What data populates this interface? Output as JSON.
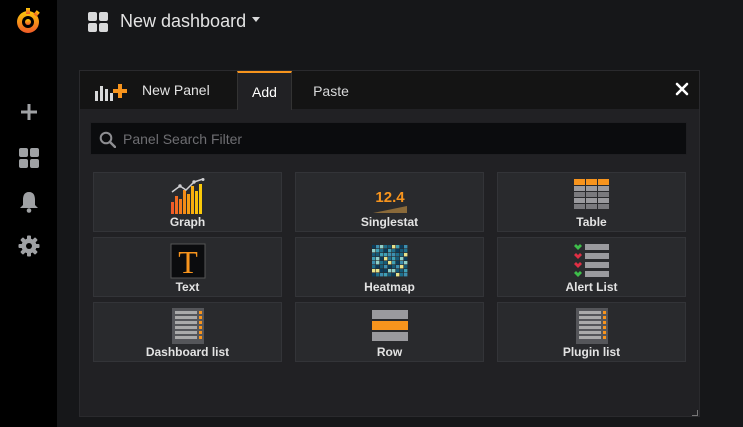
{
  "dashboard": {
    "title": "New dashboard"
  },
  "sidemenu": {
    "items": [
      {
        "name": "create",
        "icon": "plus-icon"
      },
      {
        "name": "dashboards",
        "icon": "dashboards-icon"
      },
      {
        "name": "alerting",
        "icon": "bell-icon"
      },
      {
        "name": "configuration",
        "icon": "gear-icon"
      }
    ]
  },
  "panel": {
    "title": "New Panel",
    "tabs": [
      {
        "label": "Add",
        "active": true
      },
      {
        "label": "Paste",
        "active": false
      }
    ],
    "search": {
      "placeholder": "Panel Search Filter",
      "value": ""
    },
    "cards": [
      {
        "label": "Graph"
      },
      {
        "label": "Singlestat",
        "thumb_text": "12.4"
      },
      {
        "label": "Table"
      },
      {
        "label": "Text",
        "thumb_text": "T"
      },
      {
        "label": "Heatmap"
      },
      {
        "label": "Alert List"
      },
      {
        "label": "Dashboard list"
      },
      {
        "label": "Row"
      },
      {
        "label": "Plugin list"
      }
    ]
  },
  "colors": {
    "accent": "#f7941d",
    "background": "#161719",
    "panel": "#212124",
    "card": "#292a2d"
  }
}
